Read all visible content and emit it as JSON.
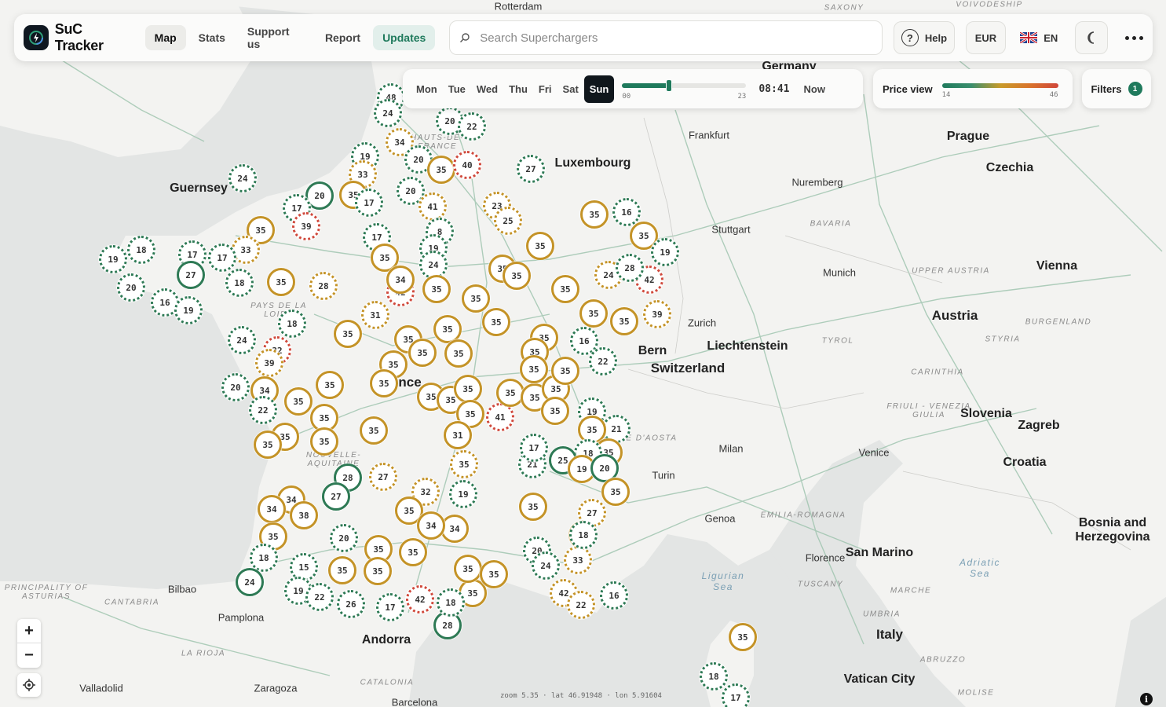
{
  "app": {
    "title": "SuC Tracker"
  },
  "nav": [
    "Map",
    "Stats",
    "Support us",
    "Report",
    "Updates"
  ],
  "search": {
    "placeholder": "Search Superchargers"
  },
  "header": {
    "help_label": "Help",
    "currency": "EUR",
    "language": "EN"
  },
  "time": {
    "days": [
      "Mon",
      "Tue",
      "Wed",
      "Thu",
      "Fri",
      "Sat",
      "Sun"
    ],
    "selected_day": "Sun",
    "slider_min_label": "00",
    "slider_max_label": "23",
    "slider_hour": 8.7,
    "clock": "08:41",
    "now_label": "Now"
  },
  "price_view": {
    "title": "Price view",
    "min": "14",
    "max": "46"
  },
  "filters": {
    "label": "Filters",
    "count": "1"
  },
  "map_status": {
    "zoom": "zoom 5.35 · lat 46.91948 · lon 5.91604"
  },
  "colors": {
    "low": "#2e7a55",
    "mid": "#c49327",
    "high": "#d0493c",
    "accent": "#1f7a5c"
  },
  "places": [
    {
      "label": "Rotterdam",
      "kind": "city"
    },
    {
      "label": "Germany",
      "kind": "country"
    },
    {
      "label": "SAXONY",
      "kind": "region"
    },
    {
      "label": "VOIVODESHIP",
      "kind": "region"
    },
    {
      "label": "Guernsey",
      "kind": "country"
    },
    {
      "label": "Luxembourg",
      "kind": "country"
    },
    {
      "label": "Frankfurt",
      "kind": "city"
    },
    {
      "label": "Prague",
      "kind": "country"
    },
    {
      "label": "Czechia",
      "kind": "country"
    },
    {
      "label": "Nuremberg",
      "kind": "city"
    },
    {
      "label": "Stuttgart",
      "kind": "city"
    },
    {
      "label": "BAVARIA",
      "kind": "region"
    },
    {
      "label": "Munich",
      "kind": "city"
    },
    {
      "label": "UPPER AUSTRIA",
      "kind": "region"
    },
    {
      "label": "Vienna",
      "kind": "country"
    },
    {
      "label": "Austria",
      "kind": "country"
    },
    {
      "label": "BURGENLAND",
      "kind": "region"
    },
    {
      "label": "STYRIA",
      "kind": "region"
    },
    {
      "label": "TYROL",
      "kind": "region"
    },
    {
      "label": "Zurich",
      "kind": "city"
    },
    {
      "label": "Liechtenstein",
      "kind": "country"
    },
    {
      "label": "Bern",
      "kind": "country"
    },
    {
      "label": "Switzerland",
      "kind": "country"
    },
    {
      "label": "CARINTHIA",
      "kind": "region"
    },
    {
      "label": "FRIULI - VENEZIA GIULIA",
      "kind": "region"
    },
    {
      "label": "Slovenia",
      "kind": "country"
    },
    {
      "label": "Zagreb",
      "kind": "country"
    },
    {
      "label": "Croatia",
      "kind": "country"
    },
    {
      "label": "VALLE D'AOSTA",
      "kind": "region"
    },
    {
      "label": "Milan",
      "kind": "city"
    },
    {
      "label": "Venice",
      "kind": "city"
    },
    {
      "label": "Turin",
      "kind": "city"
    },
    {
      "label": "Genoa",
      "kind": "city"
    },
    {
      "label": "EMILIA-ROMAGNA",
      "kind": "region"
    },
    {
      "label": "Bosnia and Herzegovina",
      "kind": "country"
    },
    {
      "label": "Florence",
      "kind": "city"
    },
    {
      "label": "San Marino",
      "kind": "country"
    },
    {
      "label": "Adriatic Sea",
      "kind": "sea"
    },
    {
      "label": "Ligurian Sea",
      "kind": "sea"
    },
    {
      "label": "TUSCANY",
      "kind": "region"
    },
    {
      "label": "MARCHE",
      "kind": "region"
    },
    {
      "label": "UMBRIA",
      "kind": "region"
    },
    {
      "label": "Italy",
      "kind": "country"
    },
    {
      "label": "ABRUZZO",
      "kind": "region"
    },
    {
      "label": "Vatican City",
      "kind": "country"
    },
    {
      "label": "MOLISE",
      "kind": "region"
    },
    {
      "label": "HAUTS-DE-FRANCE",
      "kind": "region"
    },
    {
      "label": "PAYS DE LA LOIRE",
      "kind": "region"
    },
    {
      "label": "NOUVELLE-AQUITAINE",
      "kind": "region"
    },
    {
      "label": "PRINCIPALITY OF ASTURIAS",
      "kind": "region"
    },
    {
      "label": "Bilbao",
      "kind": "city"
    },
    {
      "label": "CANTABRIA",
      "kind": "region"
    },
    {
      "label": "Pamplona",
      "kind": "city"
    },
    {
      "label": "LA RIOJA",
      "kind": "region"
    },
    {
      "label": "Andorra",
      "kind": "country"
    },
    {
      "label": "Valladolid",
      "kind": "city"
    },
    {
      "label": "Zaragoza",
      "kind": "city"
    },
    {
      "label": "CATALONIA",
      "kind": "region"
    },
    {
      "label": "Barcelona",
      "kind": "city"
    },
    {
      "label": "nce",
      "kind": "country"
    }
  ],
  "markers": [
    {
      "v": "48",
      "c": "low",
      "s": "dashed"
    },
    {
      "v": "24",
      "c": "low",
      "s": "dashed"
    },
    {
      "v": "20",
      "c": "low",
      "s": "dashed"
    },
    {
      "v": "22",
      "c": "low",
      "s": "dashed"
    },
    {
      "v": "34",
      "c": "mid",
      "s": "dashed"
    },
    {
      "v": "19",
      "c": "low",
      "s": "dashed"
    },
    {
      "v": "20",
      "c": "low",
      "s": "dashed"
    },
    {
      "v": "35",
      "c": "mid",
      "s": "solid"
    },
    {
      "v": "40",
      "c": "high",
      "s": "dashed"
    },
    {
      "v": "27",
      "c": "low",
      "s": "dashed"
    },
    {
      "v": "33",
      "c": "mid",
      "s": "dashed"
    },
    {
      "v": "24",
      "c": "low",
      "s": "dashed"
    },
    {
      "v": "20",
      "c": "low",
      "s": "solid"
    },
    {
      "v": "35",
      "c": "mid",
      "s": "solid"
    },
    {
      "v": "17",
      "c": "low",
      "s": "dashed"
    },
    {
      "v": "20",
      "c": "low",
      "s": "dashed"
    },
    {
      "v": "41",
      "c": "mid",
      "s": "dashed"
    },
    {
      "v": "23",
      "c": "mid",
      "s": "dashed"
    },
    {
      "v": "25",
      "c": "mid",
      "s": "dashed"
    },
    {
      "v": "17",
      "c": "low",
      "s": "dashed"
    },
    {
      "v": "39",
      "c": "high",
      "s": "dashed"
    },
    {
      "v": "17",
      "c": "low",
      "s": "dashed"
    },
    {
      "v": "35",
      "c": "mid",
      "s": "solid"
    },
    {
      "v": "8",
      "c": "low",
      "s": "dashed"
    },
    {
      "v": "19",
      "c": "low",
      "s": "dashed"
    },
    {
      "v": "35",
      "c": "mid",
      "s": "solid"
    },
    {
      "v": "24",
      "c": "low",
      "s": "dashed"
    },
    {
      "v": "35",
      "c": "mid",
      "s": "solid"
    },
    {
      "v": "33",
      "c": "mid",
      "s": "dashed"
    },
    {
      "v": "17",
      "c": "low",
      "s": "dashed"
    },
    {
      "v": "17",
      "c": "low",
      "s": "dashed"
    },
    {
      "v": "18",
      "c": "low",
      "s": "dashed"
    },
    {
      "v": "19",
      "c": "low",
      "s": "dashed"
    },
    {
      "v": "27",
      "c": "low",
      "s": "solid"
    },
    {
      "v": "20",
      "c": "low",
      "s": "dashed"
    },
    {
      "v": "16",
      "c": "low",
      "s": "dashed"
    },
    {
      "v": "19",
      "c": "low",
      "s": "dashed"
    },
    {
      "v": "18",
      "c": "low",
      "s": "dashed"
    },
    {
      "v": "35",
      "c": "mid",
      "s": "solid"
    },
    {
      "v": "28",
      "c": "mid",
      "s": "dashed"
    },
    {
      "v": "42",
      "c": "high",
      "s": "dashed"
    },
    {
      "v": "35",
      "c": "mid",
      "s": "solid"
    },
    {
      "v": "31",
      "c": "mid",
      "s": "dashed"
    },
    {
      "v": "35",
      "c": "mid",
      "s": "solid"
    },
    {
      "v": "35",
      "c": "mid",
      "s": "solid"
    },
    {
      "v": "35",
      "c": "mid",
      "s": "solid"
    },
    {
      "v": "35",
      "c": "mid",
      "s": "solid"
    },
    {
      "v": "35",
      "c": "mid",
      "s": "solid"
    },
    {
      "v": "18",
      "c": "low",
      "s": "dashed"
    },
    {
      "v": "24",
      "c": "low",
      "s": "dashed"
    },
    {
      "v": "35",
      "c": "mid",
      "s": "solid"
    },
    {
      "v": "32",
      "c": "high",
      "s": "dashed"
    },
    {
      "v": "39",
      "c": "mid",
      "s": "dashed"
    },
    {
      "v": "35",
      "c": "mid",
      "s": "solid"
    },
    {
      "v": "35",
      "c": "mid",
      "s": "solid"
    },
    {
      "v": "35",
      "c": "mid",
      "s": "solid"
    },
    {
      "v": "35",
      "c": "mid",
      "s": "solid"
    },
    {
      "v": "20",
      "c": "low",
      "s": "dashed"
    },
    {
      "v": "34",
      "c": "mid",
      "s": "solid"
    },
    {
      "v": "22",
      "c": "low",
      "s": "dashed"
    },
    {
      "v": "35",
      "c": "mid",
      "s": "solid"
    },
    {
      "v": "35",
      "c": "mid",
      "s": "solid"
    },
    {
      "v": "35",
      "c": "mid",
      "s": "solid"
    },
    {
      "v": "35",
      "c": "mid",
      "s": "solid"
    },
    {
      "v": "35",
      "c": "mid",
      "s": "solid"
    },
    {
      "v": "35",
      "c": "mid",
      "s": "solid"
    },
    {
      "v": "35",
      "c": "mid",
      "s": "solid"
    },
    {
      "v": "35",
      "c": "mid",
      "s": "solid"
    },
    {
      "v": "35",
      "c": "mid",
      "s": "solid"
    },
    {
      "v": "35",
      "c": "mid",
      "s": "solid"
    },
    {
      "v": "35",
      "c": "mid",
      "s": "solid"
    },
    {
      "v": "35",
      "c": "mid",
      "s": "solid"
    },
    {
      "v": "35",
      "c": "mid",
      "s": "solid"
    },
    {
      "v": "41",
      "c": "high",
      "s": "dashed"
    },
    {
      "v": "35",
      "c": "mid",
      "s": "solid"
    },
    {
      "v": "35",
      "c": "mid",
      "s": "solid"
    },
    {
      "v": "35",
      "c": "mid",
      "s": "solid"
    },
    {
      "v": "19",
      "c": "low",
      "s": "dashed"
    },
    {
      "v": "35",
      "c": "mid",
      "s": "solid"
    },
    {
      "v": "35",
      "c": "mid",
      "s": "solid"
    },
    {
      "v": "35",
      "c": "mid",
      "s": "solid"
    },
    {
      "v": "35",
      "c": "mid",
      "s": "solid"
    },
    {
      "v": "35",
      "c": "mid",
      "s": "solid"
    },
    {
      "v": "16",
      "c": "low",
      "s": "dashed"
    },
    {
      "v": "22",
      "c": "low",
      "s": "dashed"
    },
    {
      "v": "35",
      "c": "mid",
      "s": "solid"
    },
    {
      "v": "35",
      "c": "mid",
      "s": "solid"
    },
    {
      "v": "34",
      "c": "mid",
      "s": "solid"
    },
    {
      "v": "35",
      "c": "mid",
      "s": "solid"
    },
    {
      "v": "42",
      "c": "high",
      "s": "dashed"
    },
    {
      "v": "35",
      "c": "mid",
      "s": "solid"
    },
    {
      "v": "19",
      "c": "low",
      "s": "dashed"
    },
    {
      "v": "16",
      "c": "low",
      "s": "dashed"
    },
    {
      "v": "39",
      "c": "mid",
      "s": "dashed"
    },
    {
      "v": "24",
      "c": "mid",
      "s": "dashed"
    },
    {
      "v": "28",
      "c": "low",
      "s": "dashed"
    },
    {
      "v": "19",
      "c": "low",
      "s": "dashed"
    },
    {
      "v": "21",
      "c": "low",
      "s": "dashed"
    },
    {
      "v": "35",
      "c": "mid",
      "s": "solid"
    },
    {
      "v": "35",
      "c": "mid",
      "s": "solid"
    },
    {
      "v": "18",
      "c": "low",
      "s": "dashed"
    },
    {
      "v": "25",
      "c": "low",
      "s": "solid"
    },
    {
      "v": "19",
      "c": "mid",
      "s": "solid"
    },
    {
      "v": "20",
      "c": "low",
      "s": "solid"
    },
    {
      "v": "31",
      "c": "mid",
      "s": "solid"
    },
    {
      "v": "21",
      "c": "low",
      "s": "dashed"
    },
    {
      "v": "17",
      "c": "low",
      "s": "dashed"
    },
    {
      "v": "35",
      "c": "mid",
      "s": "dashed"
    },
    {
      "v": "19",
      "c": "low",
      "s": "dashed"
    },
    {
      "v": "35",
      "c": "mid",
      "s": "solid"
    },
    {
      "v": "32",
      "c": "mid",
      "s": "dashed"
    },
    {
      "v": "34",
      "c": "mid",
      "s": "solid"
    },
    {
      "v": "35",
      "c": "mid",
      "s": "solid"
    },
    {
      "v": "35",
      "c": "mid",
      "s": "solid"
    },
    {
      "v": "34",
      "c": "mid",
      "s": "solid"
    },
    {
      "v": "27",
      "c": "mid",
      "s": "dashed"
    },
    {
      "v": "35",
      "c": "mid",
      "s": "solid"
    },
    {
      "v": "28",
      "c": "low",
      "s": "solid"
    },
    {
      "v": "27",
      "c": "low",
      "s": "solid"
    },
    {
      "v": "27",
      "c": "mid",
      "s": "dashed"
    },
    {
      "v": "34",
      "c": "mid",
      "s": "solid"
    },
    {
      "v": "34",
      "c": "mid",
      "s": "solid"
    },
    {
      "v": "38",
      "c": "mid",
      "s": "solid"
    },
    {
      "v": "35",
      "c": "mid",
      "s": "solid"
    },
    {
      "v": "18",
      "c": "low",
      "s": "dashed"
    },
    {
      "v": "20",
      "c": "low",
      "s": "dashed"
    },
    {
      "v": "15",
      "c": "low",
      "s": "dashed"
    },
    {
      "v": "35",
      "c": "mid",
      "s": "solid"
    },
    {
      "v": "35",
      "c": "mid",
      "s": "solid"
    },
    {
      "v": "35",
      "c": "mid",
      "s": "solid"
    },
    {
      "v": "35",
      "c": "mid",
      "s": "solid"
    },
    {
      "v": "24",
      "c": "low",
      "s": "solid"
    },
    {
      "v": "19",
      "c": "low",
      "s": "dashed"
    },
    {
      "v": "22",
      "c": "low",
      "s": "dashed"
    },
    {
      "v": "26",
      "c": "low",
      "s": "dashed"
    },
    {
      "v": "17",
      "c": "low",
      "s": "dashed"
    },
    {
      "v": "42",
      "c": "mid",
      "s": "dashed"
    },
    {
      "v": "42",
      "c": "high",
      "s": "dashed"
    },
    {
      "v": "35",
      "c": "mid",
      "s": "solid"
    },
    {
      "v": "28",
      "c": "low",
      "s": "solid"
    },
    {
      "v": "35",
      "c": "mid",
      "s": "solid"
    },
    {
      "v": "35",
      "c": "mid",
      "s": "solid"
    },
    {
      "v": "20",
      "c": "low",
      "s": "dashed"
    },
    {
      "v": "24",
      "c": "low",
      "s": "dashed"
    },
    {
      "v": "33",
      "c": "mid",
      "s": "dashed"
    },
    {
      "v": "18",
      "c": "low",
      "s": "dashed"
    },
    {
      "v": "42",
      "c": "mid",
      "s": "dashed"
    },
    {
      "v": "22",
      "c": "mid",
      "s": "dashed"
    },
    {
      "v": "16",
      "c": "low",
      "s": "dashed"
    },
    {
      "v": "35",
      "c": "mid",
      "s": "solid"
    },
    {
      "v": "18",
      "c": "low",
      "s": "dashed"
    },
    {
      "v": "17",
      "c": "low",
      "s": "dashed"
    },
    {
      "v": "18",
      "c": "low",
      "s": "dashed"
    },
    {
      "v": "42",
      "c": "high",
      "s": "dashed"
    },
    {
      "v": "21",
      "c": "low",
      "s": "dashed"
    },
    {
      "v": "21",
      "c": "low",
      "s": "solid"
    },
    {
      "v": "35",
      "c": "mid",
      "s": "solid"
    },
    {
      "v": "35",
      "c": "mid",
      "s": "solid"
    }
  ]
}
